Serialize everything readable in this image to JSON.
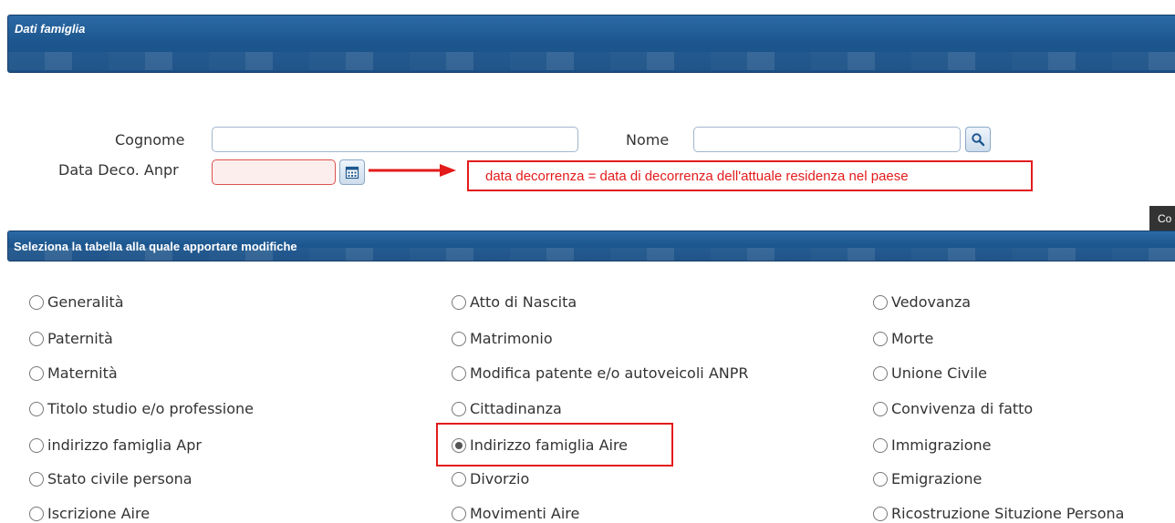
{
  "famiglia_panel": {
    "title": "Dati famiglia"
  },
  "form": {
    "cognome_label": "Cognome",
    "cognome_value": "",
    "nome_label": "Nome",
    "nome_value": "",
    "data_deco_label": "Data Deco. Anpr",
    "data_deco_value": "",
    "search_icon": "search-icon",
    "calendar_icon": "calendar-icon"
  },
  "annotation": {
    "note": "data decorrenza = data di decorrenza dell'attuale residenza nel paese",
    "color": "#e31b1b"
  },
  "side_tab": {
    "label": "Co"
  },
  "tabella_panel": {
    "title": "Seleziona la tabella alla quale apportare modifiche"
  },
  "options": {
    "col1": [
      "Generalità",
      "Paternità",
      "Maternità",
      "Titolo studio e/o professione",
      "indirizzo famiglia Apr",
      "Stato civile persona",
      "Iscrizione Aire"
    ],
    "col2": [
      "Atto di Nascita",
      "Matrimonio",
      "Modifica patente e/o autoveicoli ANPR",
      "Cittadinanza",
      "Indirizzo famiglia Aire",
      "Divorzio",
      "Movimenti Aire"
    ],
    "col3": [
      "Vedovanza",
      "Morte",
      "Unione Civile",
      "Convivenza di fatto",
      "Immigrazione",
      "Emigrazione",
      "Ricostruzione Situzione Persona"
    ],
    "selected": "Indirizzo famiglia Aire"
  },
  "colors": {
    "header_blue": "#1d578f",
    "accent_red": "#e31b1b"
  }
}
